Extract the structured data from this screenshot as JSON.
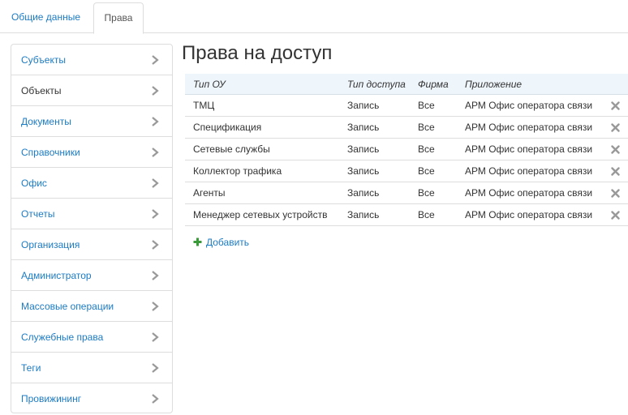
{
  "tabs": [
    {
      "label": "Общие данные"
    },
    {
      "label": "Права"
    }
  ],
  "sidebar": {
    "items": [
      {
        "label": "Субъекты"
      },
      {
        "label": "Объекты"
      },
      {
        "label": "Документы"
      },
      {
        "label": "Справочники"
      },
      {
        "label": "Офис"
      },
      {
        "label": "Отчеты"
      },
      {
        "label": "Организация"
      },
      {
        "label": "Администратор"
      },
      {
        "label": "Массовые операции"
      },
      {
        "label": "Служебные права"
      },
      {
        "label": "Теги"
      },
      {
        "label": "Провижининг"
      }
    ]
  },
  "main": {
    "title": "Права на доступ",
    "table": {
      "columns": [
        "Тип ОУ",
        "Тип доступа",
        "Фирма",
        "Приложение"
      ],
      "rows": [
        [
          "ТМЦ",
          "Запись",
          "Все",
          "АРМ Офис оператора связи"
        ],
        [
          "Спецификация",
          "Запись",
          "Все",
          "АРМ Офис оператора связи"
        ],
        [
          "Сетевые службы",
          "Запись",
          "Все",
          "АРМ Офис оператора связи"
        ],
        [
          "Коллектор трафика",
          "Запись",
          "Все",
          "АРМ Офис оператора связи"
        ],
        [
          "Агенты",
          "Запись",
          "Все",
          "АРМ Офис оператора связи"
        ],
        [
          "Менеджер сетевых устройств",
          "Запись",
          "Все",
          "АРМ Офис оператора связи"
        ]
      ]
    },
    "add_label": "Добавить"
  },
  "colors": {
    "link": "#1b7bc4",
    "header_bg": "#eef5fb",
    "add_icon": "#3a9a3a",
    "delete_icon": "#999999"
  }
}
